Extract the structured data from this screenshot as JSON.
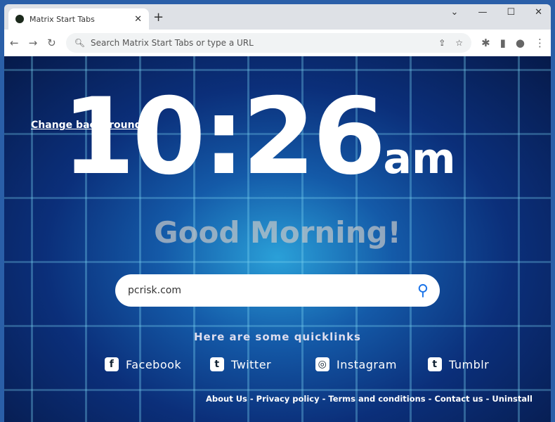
{
  "browser": {
    "tab_title": "Matrix Start Tabs",
    "omnibox_placeholder": "Search Matrix Start Tabs or type a URL"
  },
  "page": {
    "change_background": "Change background",
    "time": "10:26",
    "ampm": "am",
    "greeting": "Good Morning!",
    "search_value": "pcrisk.com",
    "quicklinks_title": "Here are some quicklinks",
    "quicklinks": [
      {
        "label": "Facebook",
        "icon": "f"
      },
      {
        "label": "Twitter",
        "icon": "t"
      },
      {
        "label": "Instagram",
        "icon": "◎"
      },
      {
        "label": "Tumblr",
        "icon": "t"
      }
    ],
    "footer": [
      "About Us",
      "Privacy policy",
      "Terms and conditions",
      "Contact us",
      "Uninstall"
    ]
  }
}
